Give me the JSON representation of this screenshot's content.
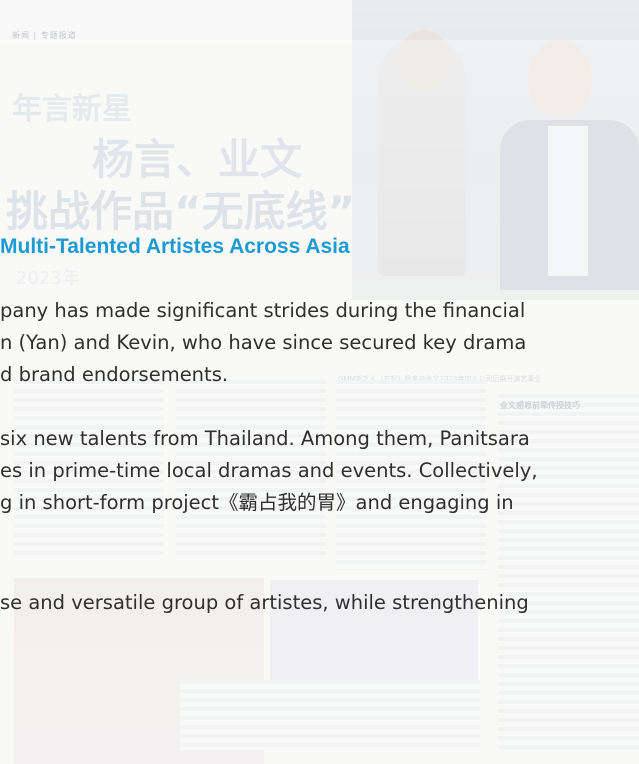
{
  "background": {
    "small_label": "新闻 | 专题报道",
    "headline_line1": "年言新星",
    "headline_line2": "杨言、业文",
    "headline_line3": "挑战作品“无底线”",
    "date_fragment": "2023年",
    "column_subhead": "业文感恩前辈传授技巧",
    "photo_caption": "GMM新艺人（左起）杨言与业文2023年加入公司后展开演艺事业"
  },
  "article": {
    "title": "Multi-Talented Artistes Across Asia",
    "paragraph1": {
      "lines": [
        "pany has made significant strides during the financial",
        "n (Yan) and Kevin, who have since secured key drama",
        "d brand endorsements."
      ]
    },
    "paragraph2": {
      "lines": [
        "six new talents from Thailand. Among them, Panitsara",
        "es in prime-time local dramas and events. Collectively,",
        "g in short-form project《霸占我的胃》and engaging in"
      ]
    },
    "paragraph3": {
      "lines": [
        "se and versatile group of artistes, while strengthening"
      ]
    }
  },
  "colors": {
    "title": "#1e9ad3",
    "body_text": "#2f2f2f"
  }
}
